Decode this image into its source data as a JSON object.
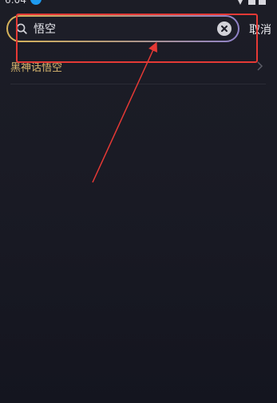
{
  "search": {
    "value": "悟空",
    "placeholder": "",
    "cancel_label": "取消"
  },
  "suggestions": [
    {
      "label": "黑神话悟空"
    }
  ],
  "colors": {
    "background": "#1a1b25",
    "search_border_start": "#d6b35a",
    "search_border_end": "#8f82c9",
    "suggestion_text": "#d9b870",
    "status_accent": "#1e9bf0",
    "annotation": "#e53935"
  },
  "icons": {
    "search": "search-icon",
    "clear": "close-circle-icon",
    "chevron": "chevron-right-icon"
  }
}
